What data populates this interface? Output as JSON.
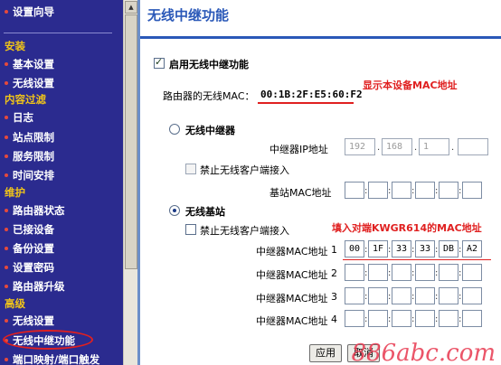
{
  "sidebar": {
    "items": [
      {
        "label": "设置向导",
        "type": "item"
      },
      {
        "label": "安装",
        "type": "section"
      },
      {
        "label": "基本设置",
        "type": "item"
      },
      {
        "label": "无线设置",
        "type": "item"
      },
      {
        "label": "内容过滤",
        "type": "section"
      },
      {
        "label": "日志",
        "type": "item"
      },
      {
        "label": "站点限制",
        "type": "item"
      },
      {
        "label": "服务限制",
        "type": "item"
      },
      {
        "label": "时间安排",
        "type": "item"
      },
      {
        "label": "维护",
        "type": "section"
      },
      {
        "label": "路由器状态",
        "type": "item"
      },
      {
        "label": "已接设备",
        "type": "item"
      },
      {
        "label": "备份设置",
        "type": "item"
      },
      {
        "label": "设置密码",
        "type": "item"
      },
      {
        "label": "路由器升级",
        "type": "item"
      },
      {
        "label": "高级",
        "type": "section"
      },
      {
        "label": "无线设置",
        "type": "item"
      },
      {
        "label": "无线中继功能",
        "type": "item",
        "active": true
      },
      {
        "label": "端口映射/端口触发",
        "type": "item"
      }
    ]
  },
  "main": {
    "title": "无线中继功能",
    "enable_repeater_label": "启用无线中继功能",
    "router_mac_label": "路由器的无线MAC：",
    "router_mac_value": "00:1B:2F:E5:60:F2",
    "annotation_router_mac": "显示本设备MAC地址",
    "repeater_mode_label": "无线中继器",
    "repeater_ip_label": "中继器IP地址",
    "repeater_ip": [
      "192",
      "168",
      "1",
      ""
    ],
    "disable_clients_label_1": "禁止无线客户端接入",
    "base_mac_label": "基站MAC地址",
    "base_mac": [
      "",
      "",
      "",
      "",
      "",
      ""
    ],
    "base_station_label": "无线基站",
    "disable_clients_label_2": "禁止无线客户端接入",
    "annotation_repeater_mac": "填入对端KWGR614的MAC地址",
    "repeater_mac_label": "中继器MAC地址",
    "repeaters": [
      {
        "index": "1",
        "mac": [
          "00",
          "1F",
          "33",
          "33",
          "DB",
          "A2"
        ]
      },
      {
        "index": "2",
        "mac": [
          "",
          "",
          "",
          "",
          "",
          ""
        ]
      },
      {
        "index": "3",
        "mac": [
          "",
          "",
          "",
          "",
          "",
          ""
        ]
      },
      {
        "index": "4",
        "mac": [
          "",
          "",
          "",
          "",
          "",
          ""
        ]
      }
    ],
    "apply_button": "应用",
    "cancel_button": "取消",
    "watermark": "886abc.com"
  },
  "colors": {
    "sidebar_bg": "#2b2b8f",
    "section_text": "#f0c419",
    "title_blue": "#2a58b8",
    "annotation_red": "#e02020"
  }
}
